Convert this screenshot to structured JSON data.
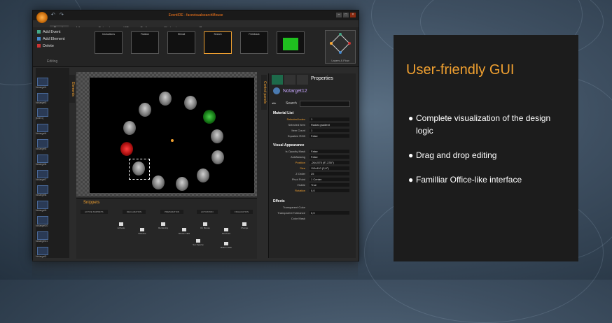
{
  "app": {
    "title": "EventIDE - facevisualsearchMouse",
    "window_buttons": [
      "–",
      "□",
      "×"
    ],
    "quick_access": {
      "undo": "↶",
      "redo": "↷"
    },
    "tabs": [
      "Events",
      "Library",
      "Snippets",
      "HQ",
      "Surface",
      "Abstract",
      "Run"
    ],
    "active_tab": "Events",
    "ribbon": {
      "add_event": "Add Event",
      "add_element": "Add Element",
      "delete": "Delete",
      "group_label": "Editing",
      "layers_label": "Layers & Flow",
      "thumbnails": [
        "Instructions",
        "Fixation",
        "Stimuli",
        "Search",
        "Feedback",
        ""
      ]
    },
    "left_panel": {
      "tab": "Elements",
      "items": [
        "Notarget1",
        "Notarget3",
        "[Doll 1]",
        "Notarget4",
        "Notarget5",
        "Notarget6",
        "Notarget7",
        "Notarget8",
        "Notarget9",
        "Notarget10",
        "Notarget11",
        "Notarget2"
      ]
    },
    "snippets": {
      "title": "Snippets",
      "categories": [
        "ACTIVE SNIPPETS",
        "DECLARATION",
        "PREPARATION",
        "ACTIVATION",
        "FINALIZATION"
      ],
      "items": [
        "Activate",
        "Release",
        "Rendering",
        "Mouse Click",
        "On Mouse",
        "Set Point",
        "Change",
        "Set Opacity",
        "Button Click"
      ]
    },
    "control_panels_tab": "Control panels",
    "properties": {
      "header": "Properties",
      "selected": "Notarget12",
      "search_label": "Search",
      "material_section": "Material List",
      "material_rows": [
        {
          "k": "Selected Index",
          "v": "1",
          "hl": true
        },
        {
          "k": "Selected Item",
          "v": "Radial gradient",
          "hl": false
        },
        {
          "k": "Item Count",
          "v": "1",
          "hl": false
        },
        {
          "k": "Equalize RGB",
          "v": "False",
          "hl": false
        }
      ],
      "visual_section": "Visual Appearance",
      "visual_rows": [
        {
          "k": "Is Opacity Mask",
          "v": "False",
          "hl": false
        },
        {
          "k": "AntiAliasing",
          "v": "False",
          "hl": false
        },
        {
          "k": "Position",
          "v": "-264,575 (8°,235°)",
          "hl": true
        },
        {
          "k": "Size",
          "v": "110x110 (2,8°)",
          "hl": true
        },
        {
          "k": "Z Order",
          "v": "25",
          "hl": false
        },
        {
          "k": "Pivot Point",
          "v": "1 Center",
          "hl": false
        },
        {
          "k": "Visible",
          "v": "True",
          "hl": false
        },
        {
          "k": "Rotation",
          "v": "0,0",
          "hl": true
        }
      ],
      "effects_section": "Effects",
      "effects_rows": [
        {
          "k": "Transparent Color",
          "v": "",
          "hl": false
        },
        {
          "k": "Transparent Tolerance",
          "v": "0,0",
          "hl": false
        },
        {
          "k": "Color Mask",
          "v": "",
          "hl": false
        }
      ]
    }
  },
  "feature": {
    "title": "User-friendly GUI",
    "bullet": "●",
    "items": [
      "Complete visualization of the design logic",
      "Drag and drop editing",
      "Familliar Office-like interface"
    ]
  },
  "colors": {
    "accent": "#f0a030",
    "panel": "#1c1c1c"
  }
}
